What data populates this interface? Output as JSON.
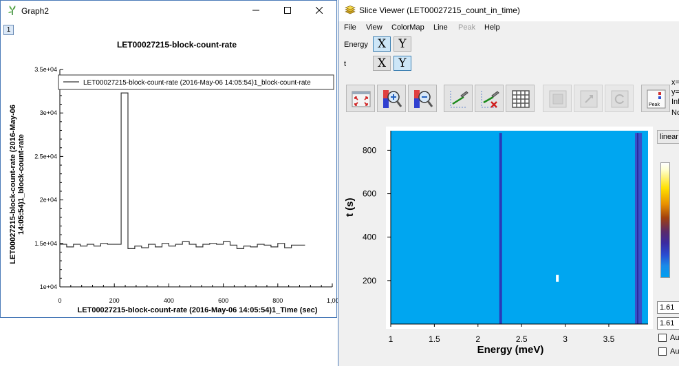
{
  "graph_window": {
    "title": "Graph2",
    "tab_label": "1",
    "plot_title": "LET00027215-block-count-rate",
    "legend_entry": "LET00027215-block-count-rate (2016-May-06 14:05:54)1_block-count-rate",
    "ylabel": "LET00027215-block-count-rate (2016-May-06 14:05:54)1_block-count-rate",
    "xlabel": "LET00027215-block-count-rate (2016-May-06 14:05:54)1_Time (sec)"
  },
  "chart_data": [
    {
      "type": "line",
      "title": "LET00027215-block-count-rate",
      "xlabel": "LET00027215-block-count-rate (2016-May-06 14:05:54)1_Time (sec)",
      "ylabel": "LET00027215-block-count-rate (2016-May-06 14:05:54)1_block-count-rate",
      "xlim": [
        0,
        1000
      ],
      "ylim": [
        10000,
        35000
      ],
      "x_ticks": [
        "0",
        "200",
        "400",
        "600",
        "800",
        "1,00"
      ],
      "y_ticks": [
        "1e+04",
        "1.5e+04",
        "2e+04",
        "2.5e+04",
        "3e+04",
        "3.5e+04"
      ],
      "series": [
        {
          "name": "LET00027215-block-count-rate (2016-May-06 14:05:54)1_block-count-rate",
          "x": [
            0,
            25,
            50,
            75,
            100,
            125,
            150,
            175,
            200,
            225,
            250,
            275,
            300,
            325,
            350,
            375,
            400,
            425,
            450,
            475,
            500,
            525,
            550,
            575,
            600,
            625,
            650,
            675,
            700,
            725,
            750,
            775,
            800,
            825,
            850,
            875
          ],
          "y": [
            14900,
            14600,
            14900,
            14700,
            14900,
            14700,
            15000,
            14900,
            14900,
            32300,
            14400,
            14700,
            14500,
            14900,
            14600,
            15000,
            14700,
            14900,
            15200,
            14900,
            14600,
            14900,
            15000,
            14900,
            15200,
            14800,
            14400,
            14700,
            14600,
            14900,
            14800,
            14600,
            15000,
            14500,
            14800,
            14800
          ]
        }
      ]
    },
    {
      "type": "heatmap",
      "xlabel": "Energy (meV)",
      "ylabel": "t (s)",
      "xlim": [
        1,
        3.95
      ],
      "ylim": [
        0,
        890
      ],
      "x_ticks": [
        "1",
        "1.5",
        "2",
        "2.5",
        "3",
        "3.5"
      ],
      "y_ticks": [
        "200",
        "400",
        "600",
        "800"
      ],
      "background_color": "#00a6f0",
      "features": [
        {
          "kind": "vertical_line",
          "x": 2.26,
          "color": "#2a3ab8"
        },
        {
          "kind": "vertical_band",
          "x0": 3.8,
          "x1": 3.88,
          "color": "#3a50c8"
        },
        {
          "kind": "spot",
          "x": 2.91,
          "y": 210,
          "color": "#ffffff"
        }
      ]
    }
  ],
  "slice_window": {
    "title": "Slice Viewer (LET00027215_count_in_time)",
    "menu": [
      "File",
      "View",
      "ColorMap",
      "Line",
      "Peak",
      "Help"
    ],
    "dims": [
      {
        "label": "Energy",
        "x": "X",
        "y": "Y",
        "active": "X"
      },
      {
        "label": "t",
        "x": "X",
        "y": "Y",
        "active": "Y"
      }
    ],
    "peak_button_label": "Peak",
    "coord_readout": [
      "x=",
      "y=",
      "Inf",
      "No"
    ],
    "scale_select": "linear",
    "colorbar_max": "1.61",
    "colorbar_min": "1.61",
    "auto_checkbox_labels": [
      "Aut",
      "Aut"
    ],
    "axis_x_title": "Energy (meV)",
    "axis_y_title": "t (s)"
  },
  "colors": {
    "heatmap_background": "#00a6f0",
    "window_border": "#4a7ab8",
    "selected_dim": "#cde6f7"
  }
}
